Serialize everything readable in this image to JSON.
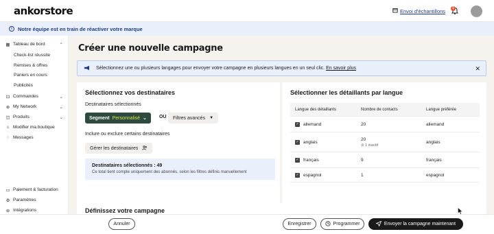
{
  "header": {
    "logo": "ankorstore",
    "sample_link": "Envoi d'échantillons",
    "notification_count": "1"
  },
  "info_banner": {
    "text": "Notre équipe est en train de réactiver votre marque"
  },
  "sidebar": {
    "sections": [
      {
        "label": "Tableau de bord",
        "icon": "grid-icon",
        "chevron": "up"
      },
      {
        "label": "Commandes",
        "icon": "cart-icon",
        "chevron": "down"
      },
      {
        "label": "My Network",
        "icon": "network-icon",
        "chevron": "down"
      },
      {
        "label": "Produits",
        "icon": "box-icon",
        "chevron": "down"
      },
      {
        "label": "Modifier ma boutique",
        "icon": "store-icon"
      },
      {
        "label": "Messages",
        "icon": "chat-icon"
      }
    ],
    "sub_items": [
      "Check-list réussite",
      "Remises & offres",
      "Paniers en cours",
      "Publicités"
    ],
    "bottom_items": [
      {
        "label": "Paiement & facturation",
        "icon": "wallet-icon"
      },
      {
        "label": "Paramètres",
        "icon": "gear-icon"
      },
      {
        "label": "Intégrations",
        "icon": "plug-icon"
      }
    ]
  },
  "main": {
    "title": "Créer une nouvelle campagne",
    "lang_banner": {
      "text": "Sélectionnez une ou plusieurs langages pour envoyer votre campagne en plusieurs langues en un seul clic.",
      "link": "En savoir plus"
    },
    "recipients": {
      "title": "Sélectionnez vos destinataires",
      "selected_label": "Destinataires sélectionnés",
      "segment_label": "Segment",
      "segment_value": "Personnalisé",
      "or": "OU",
      "filters_label": "Filtres avancés",
      "include_label": "Inclure ou exclure certains destinataires",
      "manage_label": "Gérer les destinataires",
      "summary_title": "Destinataires sélectionnés : 49",
      "summary_note": "Ce total tient compte uniquement des abonnés, selon les filtres définis manuellement"
    },
    "languages": {
      "title": "Sélectionner les détaillants par langue",
      "columns": [
        "Langue des détaillants",
        "Nombre de contacts",
        "Langue préférée"
      ],
      "rows": [
        {
          "lang": "allemand",
          "count": "20",
          "inactive": "",
          "preferred": "allemand"
        },
        {
          "lang": "anglais",
          "count": "20",
          "inactive": "1 inactif",
          "preferred": "anglais"
        },
        {
          "lang": "français",
          "count": "9",
          "inactive": "",
          "preferred": "français"
        },
        {
          "lang": "espagnol",
          "count": "1",
          "inactive": "",
          "preferred": "espagnol"
        }
      ]
    },
    "define_title": "Définissez votre campagne"
  },
  "footer": {
    "cancel": "Annuler",
    "save": "Enregistrer",
    "schedule": "Programmer",
    "send": "Envoyer la campagne maintenant"
  }
}
